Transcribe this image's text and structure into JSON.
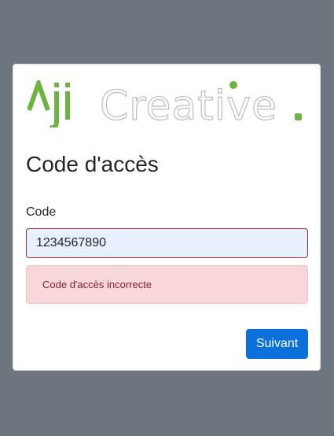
{
  "logo": {
    "text_part1": "Aji",
    "text_part2": "Creative",
    "accent_color": "#6db33f",
    "outline_color": "#bcbcbc"
  },
  "page": {
    "title": "Code d'accès"
  },
  "form": {
    "code_label": "Code",
    "code_value": "1234567890",
    "error_message": "Code d'accès incorrecte",
    "submit_label": "Suivant"
  },
  "colors": {
    "background": "#6c757d",
    "primary": "#0b6fdc",
    "error_bg": "#f8d7da",
    "error_text": "#842029",
    "error_border": "#b02a37"
  }
}
